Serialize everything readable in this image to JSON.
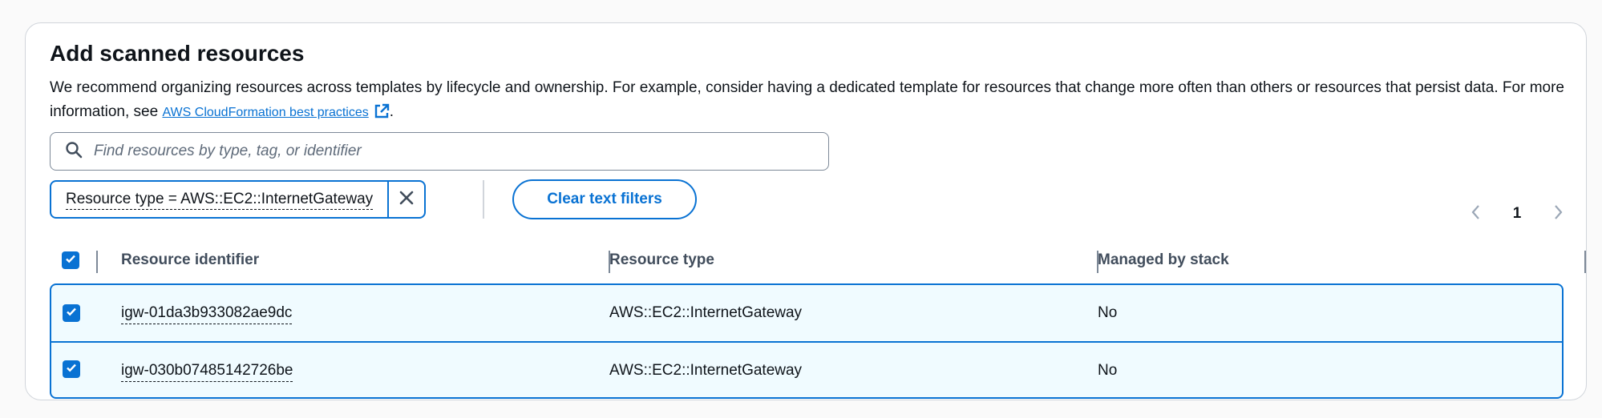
{
  "panel": {
    "title": "Add scanned resources",
    "description": "We recommend organizing resources across templates by lifecycle and ownership. For example, consider having a dedicated template for resources that change more often than others or resources that persist data. For more information, see ",
    "link_text": "AWS CloudFormation best practices",
    "description_end": "."
  },
  "search": {
    "placeholder": "Find resources by type, tag, or identifier",
    "value": ""
  },
  "filter_token": {
    "label": "Resource type = AWS::EC2::InternetGateway"
  },
  "clear_button": {
    "label": "Clear text filters"
  },
  "pagination": {
    "current_page": "1"
  },
  "table": {
    "columns": [
      "Resource identifier",
      "Resource type",
      "Managed by stack"
    ],
    "select_all_checked": true,
    "rows": [
      {
        "identifier": "igw-01da3b933082ae9dc",
        "type": "AWS::EC2::InternetGateway",
        "managed": "No",
        "checked": true
      },
      {
        "identifier": "igw-030b07485142726be",
        "type": "AWS::EC2::InternetGateway",
        "managed": "No",
        "checked": true
      }
    ]
  },
  "colors": {
    "accent": "#0972d3",
    "selected_row_bg": "#f0fbff",
    "text": "#0f141a"
  },
  "icons": [
    "search-icon",
    "external-link-icon",
    "close-icon",
    "chevron-left-icon",
    "chevron-right-icon",
    "check-icon"
  ]
}
